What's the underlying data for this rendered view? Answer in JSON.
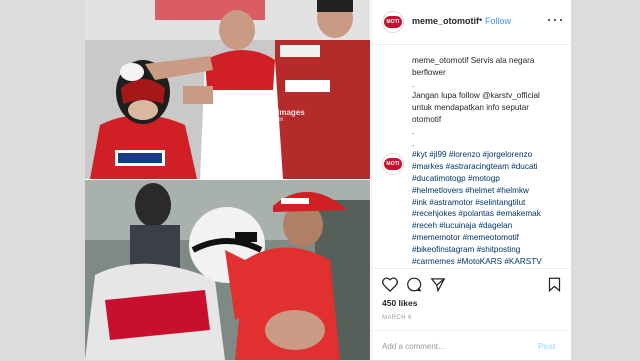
{
  "post": {
    "username": "meme_otomotif",
    "separator": "•",
    "follow_label": "Follow",
    "avatar_text": "MOTI",
    "more_icon": "ellipsis-icon",
    "watermark": "gettyimages",
    "watermark_sub": "MTF Credit",
    "caption_lines": [
      {
        "text": "meme_otomotif Servis ala negara",
        "cls": ""
      },
      {
        "text": "berflower",
        "cls": ""
      },
      {
        "text": ".",
        "cls": ""
      },
      {
        "text": "Jangan lupa follow @karstv_official",
        "cls": ""
      },
      {
        "text": "untuk mendapatkan info seputar",
        "cls": ""
      },
      {
        "text": "otomotif",
        "cls": ""
      },
      {
        "text": ".",
        "cls": ""
      },
      {
        "text": ".",
        "cls": ""
      },
      {
        "text": "#kyt #jl99 #lorenzo #jorgelorenzo",
        "cls": "tag"
      },
      {
        "text": "#markes #astraracingteam #ducati",
        "cls": "tag"
      },
      {
        "text": "#ducatimotogp #motogp",
        "cls": "tag"
      },
      {
        "text": "#helmetlovers #helmet #helmkw",
        "cls": "tag"
      },
      {
        "text": "#ink #astramotor #selintangtilut",
        "cls": "tag"
      },
      {
        "text": "#recehjokes #polantas #emakemak",
        "cls": "tag"
      },
      {
        "text": "#receh #lucuinaja #dagelan",
        "cls": "tag"
      },
      {
        "text": "#mememotor #memeotomotif",
        "cls": "tag"
      },
      {
        "text": "#bikeofinstagram #shitposting",
        "cls": "tag"
      },
      {
        "text": "#carmemes #MotoKARS #KARSTV",
        "cls": "tag"
      }
    ],
    "likes": "450 likes",
    "date": "MARCH 6",
    "add_comment_placeholder": "Add a comment...",
    "post_label": "Post"
  },
  "colors": {
    "link": "#3897f0",
    "hashtag": "#003569",
    "brand_red": "#c8102e",
    "background": "#dcdcdc"
  }
}
